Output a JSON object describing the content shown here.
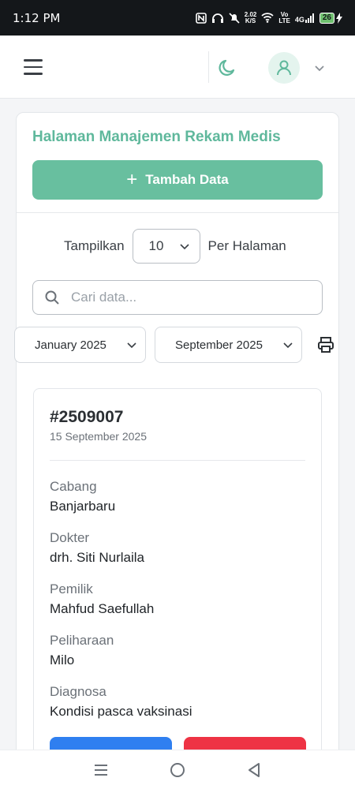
{
  "status_bar": {
    "time": "1:12 PM",
    "net_speed_top": "2.02",
    "net_speed_bottom": "K/S",
    "volte_top": "Vo",
    "volte_bottom": "LTE",
    "signal": "4G",
    "battery": "26"
  },
  "header": {
    "menu_icon": "hamburger-icon",
    "theme_icon": "moon-icon",
    "user_icon": "user-icon"
  },
  "page": {
    "title": "Halaman Manajemen Rekam Medis",
    "add_button_label": "Tambah Data",
    "per_page_prefix": "Tampilkan",
    "per_page_value": "10",
    "per_page_suffix": "Per Halaman",
    "search_placeholder": "Cari data...",
    "start_month": "January 2025",
    "end_month": "September 2025"
  },
  "record": {
    "id": "#2509007",
    "date": "15 September 2025",
    "fields": [
      {
        "label": "Cabang",
        "value": "Banjarbaru"
      },
      {
        "label": "Dokter",
        "value": "drh. Siti Nurlaila"
      },
      {
        "label": "Pemilik",
        "value": "Mahfud Saefullah"
      },
      {
        "label": "Peliharaan",
        "value": "Milo"
      },
      {
        "label": "Diagnosa",
        "value": "Kondisi pasca vaksinasi"
      }
    ]
  },
  "colors": {
    "accent": "#5fb89c",
    "button": "#68bf9f",
    "edit": "#2f7ff0",
    "delete": "#ee3344"
  }
}
